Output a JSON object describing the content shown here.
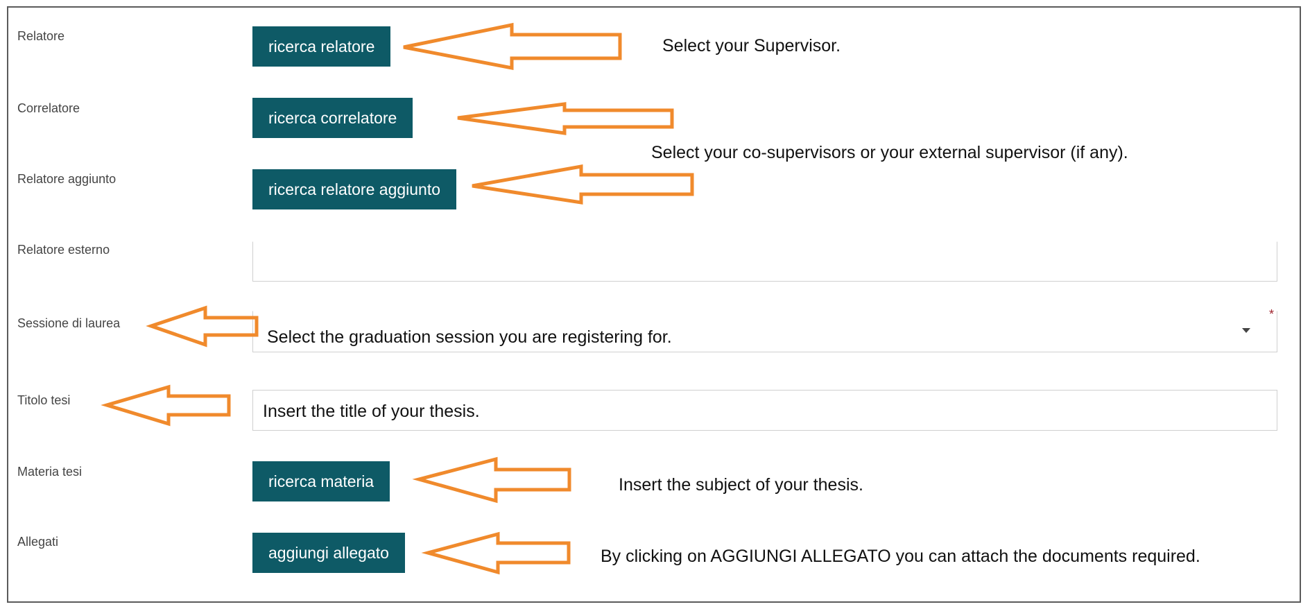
{
  "rows": {
    "relatore": {
      "label": "Relatore",
      "button": "ricerca relatore"
    },
    "correlatore": {
      "label": "Correlatore",
      "button": "ricerca correlatore"
    },
    "relatore_aggiunto": {
      "label": "Relatore aggiunto",
      "button": "ricerca relatore aggiunto"
    },
    "relatore_esterno": {
      "label": "Relatore esterno",
      "value": ""
    },
    "sessione": {
      "label": "Sessione di laurea",
      "value": "Select the graduation session you are registering for.",
      "required": "*"
    },
    "titolo": {
      "label": "Titolo tesi",
      "value": "Insert the title of your thesis."
    },
    "materia": {
      "label": "Materia tesi",
      "button": "ricerca materia"
    },
    "allegati": {
      "label": "Allegati",
      "button": "aggiungi allegato"
    }
  },
  "annotations": {
    "supervisor": "Select your Supervisor.",
    "co_supervisors": "Select your co-supervisors or your external supervisor (if any).",
    "subject": "Insert the subject of your thesis.",
    "attachments": "By clicking on AGGIUNGI ALLEGATO you can attach the documents required."
  },
  "colors": {
    "button_bg": "#0e5a66",
    "arrow": "#f08a2c",
    "required_mark": "#a0242e"
  },
  "icons": {
    "annotation_arrow": "arrow-left-icon",
    "select_caret": "chevron-down-icon"
  }
}
